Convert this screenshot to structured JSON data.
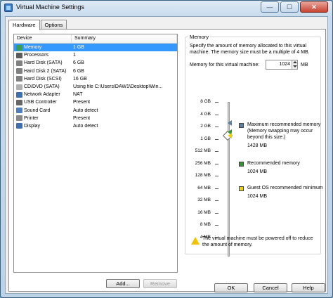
{
  "window": {
    "title": "Virtual Machine Settings"
  },
  "window_controls": {
    "minimize": "—",
    "maximize": "☐",
    "close": "✕"
  },
  "tabs": [
    {
      "label": "Hardware"
    },
    {
      "label": "Options"
    }
  ],
  "device_list": {
    "headers": {
      "device": "Device",
      "summary": "Summary"
    },
    "rows": [
      {
        "device": "Memory",
        "summary": "1 GB",
        "icon": "memory-icon",
        "color": "#3aa050"
      },
      {
        "device": "Processors",
        "summary": "1",
        "icon": "processor-icon",
        "color": "#5c5c5c"
      },
      {
        "device": "Hard Disk (SATA)",
        "summary": "6 GB",
        "icon": "hard-disk-icon",
        "color": "#808080"
      },
      {
        "device": "Hard Disk 2 (SATA)",
        "summary": "6 GB",
        "icon": "hard-disk-icon",
        "color": "#808080"
      },
      {
        "device": "Hard Disk (SCSI)",
        "summary": "16 GB",
        "icon": "hard-disk-icon",
        "color": "#808080"
      },
      {
        "device": "CD/DVD (SATA)",
        "summary": "Using file C:\\Users\\DAW1\\Desktop\\Win...",
        "icon": "cd-dvd-icon",
        "color": "#b0b0b0"
      },
      {
        "device": "Network Adapter",
        "summary": "NAT",
        "icon": "network-adapter-icon",
        "color": "#3a6fb0"
      },
      {
        "device": "USB Controller",
        "summary": "Present",
        "icon": "usb-controller-icon",
        "color": "#666666"
      },
      {
        "device": "Sound Card",
        "summary": "Auto detect",
        "icon": "sound-card-icon",
        "color": "#4a7fc0"
      },
      {
        "device": "Printer",
        "summary": "Present",
        "icon": "printer-icon",
        "color": "#888888"
      },
      {
        "device": "Display",
        "summary": "Auto detect",
        "icon": "display-icon",
        "color": "#3a6fb0"
      }
    ]
  },
  "buttons": {
    "add": "Add...",
    "remove": "Remove",
    "ok": "OK",
    "cancel": "Cancel",
    "help": "Help"
  },
  "memory": {
    "group_title": "Memory",
    "description": "Specify the amount of memory allocated to this virtual machine. The memory size must be a multiple of 4 MB.",
    "field_label": "Memory for this virtual machine:",
    "value": "1024",
    "unit": "MB",
    "scale": [
      "8 GB",
      "4 GB",
      "2 GB",
      "1 GB",
      "512 MB",
      "256 MB",
      "128 MB",
      "64 MB",
      "32 MB",
      "16 MB",
      "8 MB",
      "4 MB"
    ],
    "legend": [
      {
        "label": "Maximum recommended memory",
        "note": "(Memory swapping may occur beyond this size.)",
        "value": "1428 MB",
        "color": "#5b7fa6"
      },
      {
        "label": "Recommended memory",
        "value": "1024 MB",
        "color": "#2e9a2e"
      },
      {
        "label": "Guest OS recommended minimum",
        "value": "1024 MB",
        "color": "#f2d200"
      }
    ],
    "warning": "The virtual machine must be powered off to reduce the amount of memory."
  }
}
